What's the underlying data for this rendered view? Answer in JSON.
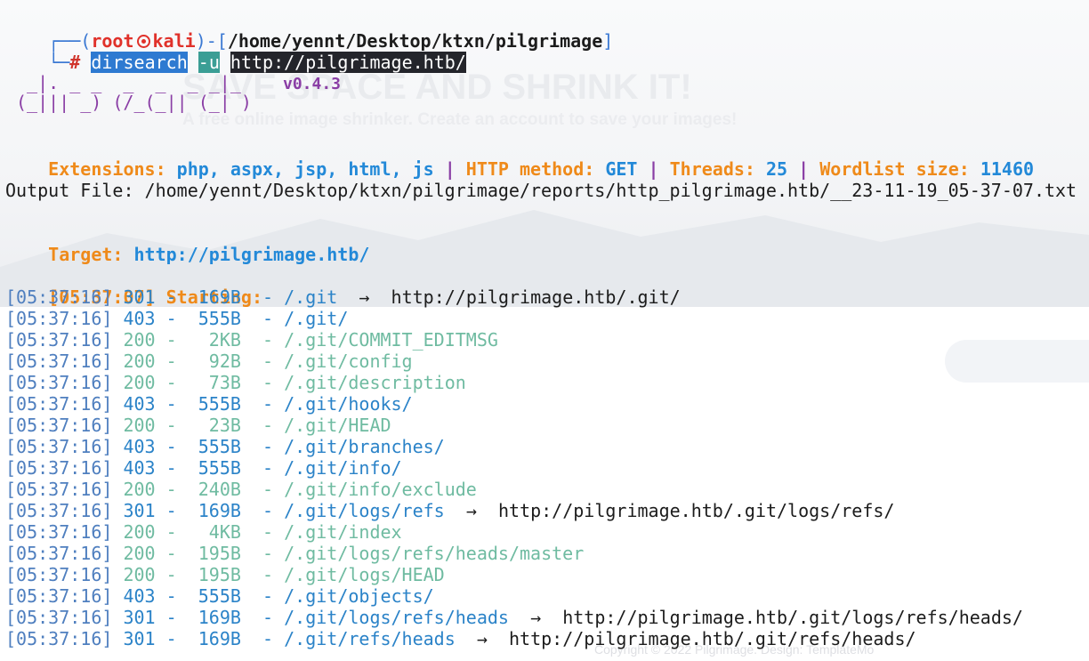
{
  "background": {
    "title": "SAVE SPACE AND SHRINK IT!",
    "subtitle": "A free online image shrinker. Create an account to save your images!",
    "footer": "Copyright © 2022 Pilgrimage. Design: TemplateMo"
  },
  "prompt": {
    "user": "root",
    "host": "kali",
    "cwd": "/home/yennt/Desktop/ktxn/pilgrimage",
    "symbol": "#",
    "command": "dirsearch",
    "flag": "-u",
    "url": "http://pilgrimage.htb/"
  },
  "banner": {
    "logo_top": " _|. _ _  _  _  _ _|_",
    "logo_bottom": "(_||| _) (/_(_|| (_| )",
    "version": "v0.4.3"
  },
  "config": {
    "extensions_label": "Extensions:",
    "extensions_value": "php, aspx, jsp, html, js",
    "method_label": "HTTP method:",
    "method_value": "GET",
    "threads_label": "Threads:",
    "threads_value": "25",
    "wordlist_label": "Wordlist size:",
    "wordlist_value": "11460",
    "separator": "|"
  },
  "output_file": "Output File: /home/yennt/Desktop/ktxn/pilgrimage/reports/http_pilgrimage.htb/__23-11-19_05-37-07.txt",
  "target": {
    "label": "Target:",
    "value": "http://pilgrimage.htb/"
  },
  "starting": {
    "time": "[05:37:07]",
    "label": "Starting:"
  },
  "results": [
    {
      "time": "[05:37:16]",
      "status": "301",
      "size": "169B",
      "path": "/.git",
      "redirect": "http://pilgrimage.htb/.git/"
    },
    {
      "time": "[05:37:16]",
      "status": "403",
      "size": "555B",
      "path": "/.git/"
    },
    {
      "time": "[05:37:16]",
      "status": "200",
      "size": "2KB",
      "path": "/.git/COMMIT_EDITMSG"
    },
    {
      "time": "[05:37:16]",
      "status": "200",
      "size": "92B",
      "path": "/.git/config"
    },
    {
      "time": "[05:37:16]",
      "status": "200",
      "size": "73B",
      "path": "/.git/description"
    },
    {
      "time": "[05:37:16]",
      "status": "403",
      "size": "555B",
      "path": "/.git/hooks/"
    },
    {
      "time": "[05:37:16]",
      "status": "200",
      "size": "23B",
      "path": "/.git/HEAD"
    },
    {
      "time": "[05:37:16]",
      "status": "403",
      "size": "555B",
      "path": "/.git/branches/"
    },
    {
      "time": "[05:37:16]",
      "status": "403",
      "size": "555B",
      "path": "/.git/info/"
    },
    {
      "time": "[05:37:16]",
      "status": "200",
      "size": "240B",
      "path": "/.git/info/exclude"
    },
    {
      "time": "[05:37:16]",
      "status": "301",
      "size": "169B",
      "path": "/.git/logs/refs",
      "redirect": "http://pilgrimage.htb/.git/logs/refs/"
    },
    {
      "time": "[05:37:16]",
      "status": "200",
      "size": "4KB",
      "path": "/.git/index"
    },
    {
      "time": "[05:37:16]",
      "status": "200",
      "size": "195B",
      "path": "/.git/logs/refs/heads/master"
    },
    {
      "time": "[05:37:16]",
      "status": "200",
      "size": "195B",
      "path": "/.git/logs/HEAD"
    },
    {
      "time": "[05:37:16]",
      "status": "403",
      "size": "555B",
      "path": "/.git/objects/"
    },
    {
      "time": "[05:37:16]",
      "status": "301",
      "size": "169B",
      "path": "/.git/logs/refs/heads",
      "redirect": "http://pilgrimage.htb/.git/logs/refs/heads/"
    },
    {
      "time": "[05:37:16]",
      "status": "301",
      "size": "169B",
      "path": "/.git/refs/heads",
      "redirect": "http://pilgrimage.htb/.git/refs/heads/"
    }
  ],
  "colors": {
    "status_200": "#6fbba1",
    "status_301": "#2b83c8",
    "status_403": "#2b83c8",
    "orange": "#ef8a1a",
    "blue": "#2389d8"
  }
}
